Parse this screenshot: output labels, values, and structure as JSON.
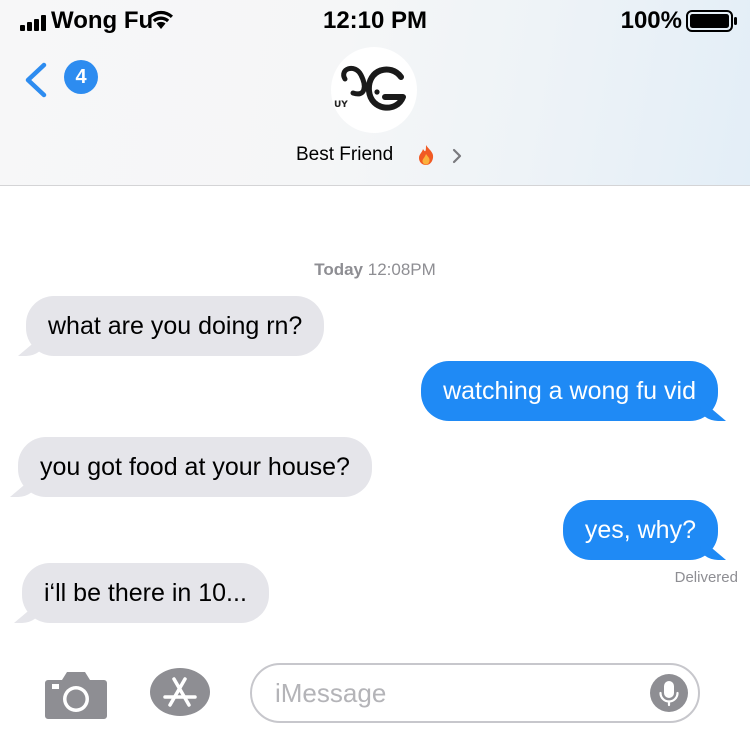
{
  "status_bar": {
    "carrier": "Wong Fu",
    "time": "12:10 PM",
    "battery": "100%",
    "signal_bars": 4,
    "battery_level": 1.0
  },
  "nav": {
    "unread_count": "4",
    "contact_name": "Best Friend",
    "avatar_text": "UY",
    "back_icon": "chevron-left-icon",
    "detail_icon": "chevron-right-icon",
    "emoji_icon": "fire-icon"
  },
  "conversation": {
    "timestamp_day": "Today",
    "timestamp_time": "12:08PM",
    "messages": [
      {
        "direction": "in",
        "text": "what are you doing rn?"
      },
      {
        "direction": "out",
        "text": "watching a wong fu vid"
      },
      {
        "direction": "in",
        "text": "you got food at your house?"
      },
      {
        "direction": "out",
        "text": "yes, why?"
      },
      {
        "direction": "in",
        "text": "i‘ll be there in 10..."
      }
    ],
    "delivery_status": "Delivered"
  },
  "input_bar": {
    "placeholder": "iMessage",
    "camera_icon": "camera-icon",
    "apps_icon": "app-store-icon",
    "mic_icon": "microphone-icon"
  },
  "colors": {
    "outgoing_bubble": "#1f8af5",
    "incoming_bubble": "#e5e5ea",
    "accent": "#2d8cf0",
    "muted_text": "#8e8e93"
  }
}
